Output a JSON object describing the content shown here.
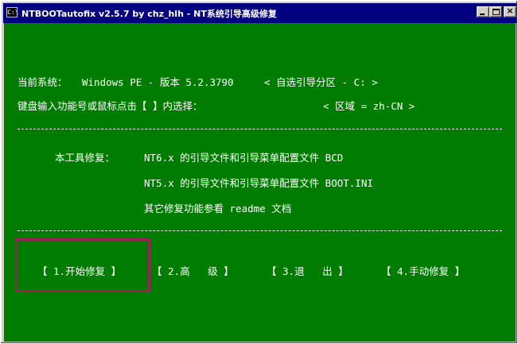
{
  "window": {
    "title": "NTBOOTautofix v2.5.7 by chz_hlh - NT系统引导高级修复",
    "icon_label": "C:\\",
    "controls": {
      "minimize": "minimize",
      "maximize": "maximize",
      "close": "×"
    }
  },
  "console": {
    "background": "#007d00",
    "system_label": "当前系统：",
    "system_value": "Windows PE - 版本 5.2.3790",
    "partition_option": "< 自选引导分区 - C: >",
    "input_prompt": "键盘输入功能号或鼠标点击【 】内选择：",
    "region_option": "< 区域 = zh-CN >",
    "repair_heading": "本工具修复：",
    "repair_lines": [
      "NT6.x 的引导文件和引导菜单配置文件 BCD",
      "NT5.x 的引导文件和引导菜单配置文件 BOOT.INI",
      "其它修复功能参看 readme 文档"
    ]
  },
  "menu": {
    "items": [
      "【 1.开始修复 】",
      "【 2.高   级 】",
      "【 3.退   出 】",
      "【 4.手动修复 】"
    ],
    "highlight_color": "#a0205a"
  }
}
